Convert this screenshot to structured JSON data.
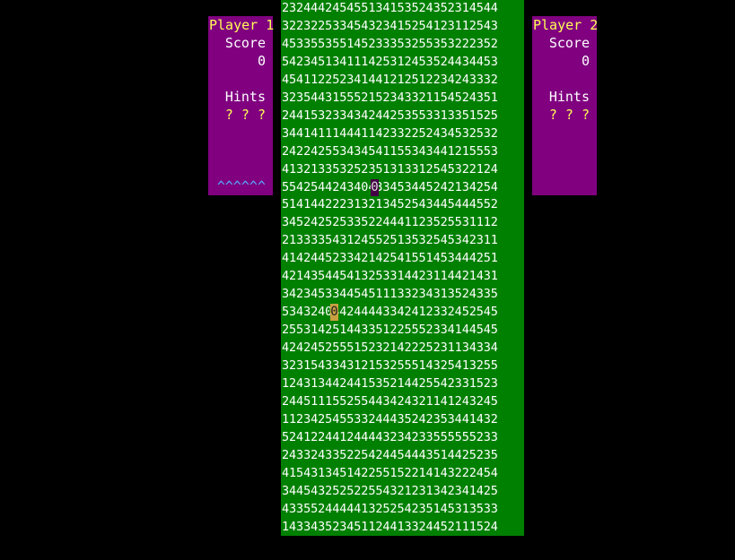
{
  "player1": {
    "title": "Player 1",
    "score_label": "Score",
    "score": "0",
    "hints_label": "Hints",
    "hints": "? ? ?",
    "carets": "^^^^^^"
  },
  "player2": {
    "title": "Player 2",
    "score_label": "Score",
    "score": "0",
    "hints_label": "Hints",
    "hints": "? ? ?"
  },
  "board": {
    "rows": [
      "232444245455134153524352314544",
      "322322533454323415254123112543",
      "453355355145233353255353222352",
      "542345134111425312453524434453",
      "454112252341441212512234243332",
      "323544315552152343321154524351",
      "244153233434244253553313351525",
      "344141114441142332252434532532",
      "242242553434541155343441215553",
      "413213353252351313312545322124",
      "554254424340433453445242134254",
      "514144222313213452543445444552",
      "345242525335224441123525531112",
      "213333543124552513532545342311",
      "414244523342142541551453444251",
      "421435445413253314423114421431",
      "342345334454511133234313524335",
      "534324044244443342412332452545",
      "255314251443351225552334144545",
      "424245255515232142225231134334",
      "323154334312153255514325413255",
      "124313442441535214425542331523",
      "244511155255443424321141243245",
      "112342545533244435242353441432",
      "524122441244443234233555555233",
      "243324335225424454443514425235",
      "415431345142255152214143222454",
      "344543252522554321231342341425",
      "433552444441325254235145313533",
      "143343523451124413324452111524"
    ],
    "cursor1": {
      "row": 10,
      "col": 11,
      "glyph": "0"
    },
    "cursor2": {
      "row": 17,
      "col": 6,
      "glyph": "0"
    }
  },
  "colors": {
    "panel": "#800080",
    "board": "#008000",
    "title": "#ffff55",
    "carets": "#55aaff"
  }
}
